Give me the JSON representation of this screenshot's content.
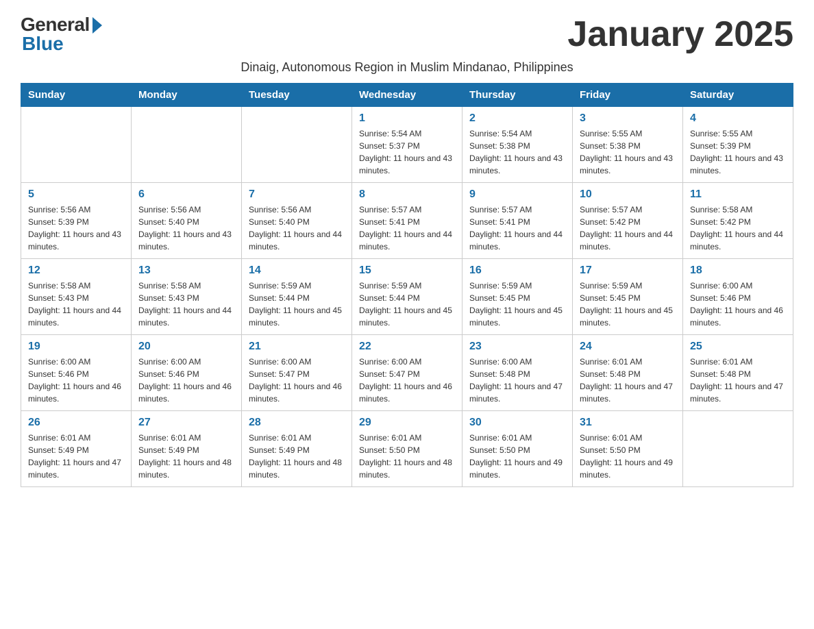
{
  "logo": {
    "general": "General",
    "blue": "Blue"
  },
  "page_title": "January 2025",
  "subtitle": "Dinaig, Autonomous Region in Muslim Mindanao, Philippines",
  "days_of_week": [
    "Sunday",
    "Monday",
    "Tuesday",
    "Wednesday",
    "Thursday",
    "Friday",
    "Saturday"
  ],
  "weeks": [
    [
      {
        "day": "",
        "info": ""
      },
      {
        "day": "",
        "info": ""
      },
      {
        "day": "",
        "info": ""
      },
      {
        "day": "1",
        "info": "Sunrise: 5:54 AM\nSunset: 5:37 PM\nDaylight: 11 hours and 43 minutes."
      },
      {
        "day": "2",
        "info": "Sunrise: 5:54 AM\nSunset: 5:38 PM\nDaylight: 11 hours and 43 minutes."
      },
      {
        "day": "3",
        "info": "Sunrise: 5:55 AM\nSunset: 5:38 PM\nDaylight: 11 hours and 43 minutes."
      },
      {
        "day": "4",
        "info": "Sunrise: 5:55 AM\nSunset: 5:39 PM\nDaylight: 11 hours and 43 minutes."
      }
    ],
    [
      {
        "day": "5",
        "info": "Sunrise: 5:56 AM\nSunset: 5:39 PM\nDaylight: 11 hours and 43 minutes."
      },
      {
        "day": "6",
        "info": "Sunrise: 5:56 AM\nSunset: 5:40 PM\nDaylight: 11 hours and 43 minutes."
      },
      {
        "day": "7",
        "info": "Sunrise: 5:56 AM\nSunset: 5:40 PM\nDaylight: 11 hours and 44 minutes."
      },
      {
        "day": "8",
        "info": "Sunrise: 5:57 AM\nSunset: 5:41 PM\nDaylight: 11 hours and 44 minutes."
      },
      {
        "day": "9",
        "info": "Sunrise: 5:57 AM\nSunset: 5:41 PM\nDaylight: 11 hours and 44 minutes."
      },
      {
        "day": "10",
        "info": "Sunrise: 5:57 AM\nSunset: 5:42 PM\nDaylight: 11 hours and 44 minutes."
      },
      {
        "day": "11",
        "info": "Sunrise: 5:58 AM\nSunset: 5:42 PM\nDaylight: 11 hours and 44 minutes."
      }
    ],
    [
      {
        "day": "12",
        "info": "Sunrise: 5:58 AM\nSunset: 5:43 PM\nDaylight: 11 hours and 44 minutes."
      },
      {
        "day": "13",
        "info": "Sunrise: 5:58 AM\nSunset: 5:43 PM\nDaylight: 11 hours and 44 minutes."
      },
      {
        "day": "14",
        "info": "Sunrise: 5:59 AM\nSunset: 5:44 PM\nDaylight: 11 hours and 45 minutes."
      },
      {
        "day": "15",
        "info": "Sunrise: 5:59 AM\nSunset: 5:44 PM\nDaylight: 11 hours and 45 minutes."
      },
      {
        "day": "16",
        "info": "Sunrise: 5:59 AM\nSunset: 5:45 PM\nDaylight: 11 hours and 45 minutes."
      },
      {
        "day": "17",
        "info": "Sunrise: 5:59 AM\nSunset: 5:45 PM\nDaylight: 11 hours and 45 minutes."
      },
      {
        "day": "18",
        "info": "Sunrise: 6:00 AM\nSunset: 5:46 PM\nDaylight: 11 hours and 46 minutes."
      }
    ],
    [
      {
        "day": "19",
        "info": "Sunrise: 6:00 AM\nSunset: 5:46 PM\nDaylight: 11 hours and 46 minutes."
      },
      {
        "day": "20",
        "info": "Sunrise: 6:00 AM\nSunset: 5:46 PM\nDaylight: 11 hours and 46 minutes."
      },
      {
        "day": "21",
        "info": "Sunrise: 6:00 AM\nSunset: 5:47 PM\nDaylight: 11 hours and 46 minutes."
      },
      {
        "day": "22",
        "info": "Sunrise: 6:00 AM\nSunset: 5:47 PM\nDaylight: 11 hours and 46 minutes."
      },
      {
        "day": "23",
        "info": "Sunrise: 6:00 AM\nSunset: 5:48 PM\nDaylight: 11 hours and 47 minutes."
      },
      {
        "day": "24",
        "info": "Sunrise: 6:01 AM\nSunset: 5:48 PM\nDaylight: 11 hours and 47 minutes."
      },
      {
        "day": "25",
        "info": "Sunrise: 6:01 AM\nSunset: 5:48 PM\nDaylight: 11 hours and 47 minutes."
      }
    ],
    [
      {
        "day": "26",
        "info": "Sunrise: 6:01 AM\nSunset: 5:49 PM\nDaylight: 11 hours and 47 minutes."
      },
      {
        "day": "27",
        "info": "Sunrise: 6:01 AM\nSunset: 5:49 PM\nDaylight: 11 hours and 48 minutes."
      },
      {
        "day": "28",
        "info": "Sunrise: 6:01 AM\nSunset: 5:49 PM\nDaylight: 11 hours and 48 minutes."
      },
      {
        "day": "29",
        "info": "Sunrise: 6:01 AM\nSunset: 5:50 PM\nDaylight: 11 hours and 48 minutes."
      },
      {
        "day": "30",
        "info": "Sunrise: 6:01 AM\nSunset: 5:50 PM\nDaylight: 11 hours and 49 minutes."
      },
      {
        "day": "31",
        "info": "Sunrise: 6:01 AM\nSunset: 5:50 PM\nDaylight: 11 hours and 49 minutes."
      },
      {
        "day": "",
        "info": ""
      }
    ]
  ]
}
